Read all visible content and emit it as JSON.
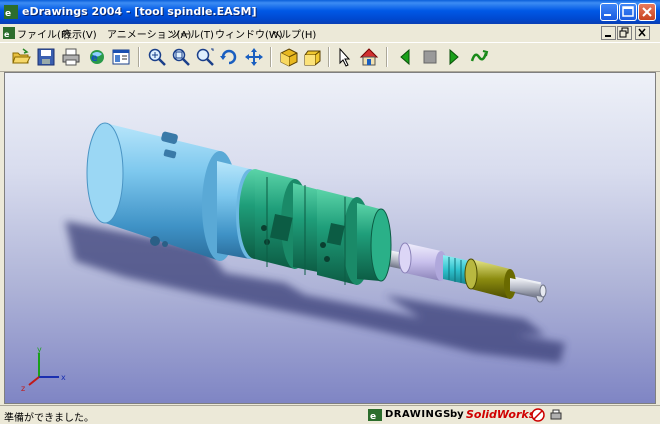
{
  "window": {
    "title": "eDrawings 2004 - [tool spindle.EASM]"
  },
  "menubar": {
    "items": [
      {
        "label": "ファイル(F)"
      },
      {
        "label": "表示(V)"
      },
      {
        "label": "アニメーション(A)"
      },
      {
        "label": "ツール(T)"
      },
      {
        "label": "ウィンドウ(W)"
      },
      {
        "label": "ヘルプ(H)"
      }
    ]
  },
  "toolbar": {
    "tools": [
      {
        "icon": "open-folder-icon"
      },
      {
        "icon": "save-icon"
      },
      {
        "icon": "print-icon"
      },
      {
        "icon": "send-mail-icon"
      },
      {
        "icon": "properties-icon"
      },
      {
        "icon": "zoom-icon"
      },
      {
        "icon": "zoom-to-fit-icon"
      },
      {
        "icon": "zoom-to-area-icon"
      },
      {
        "icon": "rotate-icon"
      },
      {
        "icon": "pan-icon"
      },
      {
        "icon": "shaded-cube-icon"
      },
      {
        "icon": "perspective-cube-icon"
      },
      {
        "icon": "select-arrow-icon"
      },
      {
        "icon": "home-icon"
      },
      {
        "icon": "previous-icon"
      },
      {
        "icon": "stop-icon"
      },
      {
        "icon": "play-icon"
      },
      {
        "icon": "continuous-play-icon"
      }
    ]
  },
  "axes": {
    "x": "x",
    "y": "y",
    "z": "z"
  },
  "statusbar": {
    "text": "準備ができました。",
    "brand_word": "DRAWINGS",
    "brand_by": "by",
    "brand_company": "SolidWorks"
  },
  "colors": {
    "title_blue": "#0058e6",
    "housing_cyan": "#7ec8ee",
    "coupling_green": "#1f9e7a",
    "sleeve_lavender": "#c8c0ec",
    "gear_teal": "#2ec1cc",
    "collar_olive": "#8c8c10",
    "shaft_gray": "#b8bcc8",
    "brand_red": "#d00000"
  }
}
